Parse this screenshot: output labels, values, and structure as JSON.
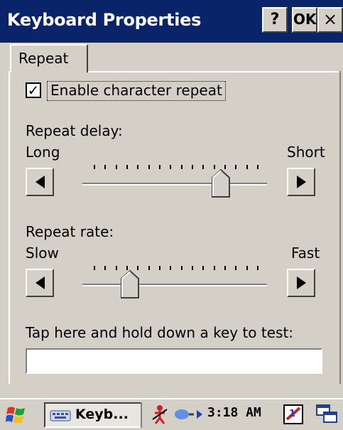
{
  "window": {
    "title": "Keyboard Properties",
    "help_label": "?",
    "ok_label": "OK",
    "close_label": "×"
  },
  "tabs": [
    {
      "label": "Repeat"
    }
  ],
  "repeat": {
    "enable_checkbox": {
      "label": "Enable character repeat",
      "checked": true,
      "check_glyph": "✓"
    },
    "delay": {
      "label": "Repeat delay:",
      "min_label": "Long",
      "max_label": "Short",
      "value_fraction": 0.78
    },
    "rate": {
      "label": "Repeat rate:",
      "min_label": "Slow",
      "max_label": "Fast",
      "value_fraction": 0.22
    },
    "test_label": "Tap here and hold down a key to test:",
    "test_input_value": ""
  },
  "taskbar": {
    "task_label": "Keyb...",
    "clock": "3:18 AM"
  },
  "icons": {
    "start": "windows-flag-icon",
    "task": "keyboard-icon",
    "tray": [
      "network-disconnected-icon",
      "connection-icon",
      "play-arrow-icon",
      "input-panel-icon",
      "desktop-icon"
    ]
  },
  "colors": {
    "titlebar": "#0a246a",
    "window_bg": "#d4d0c8"
  }
}
